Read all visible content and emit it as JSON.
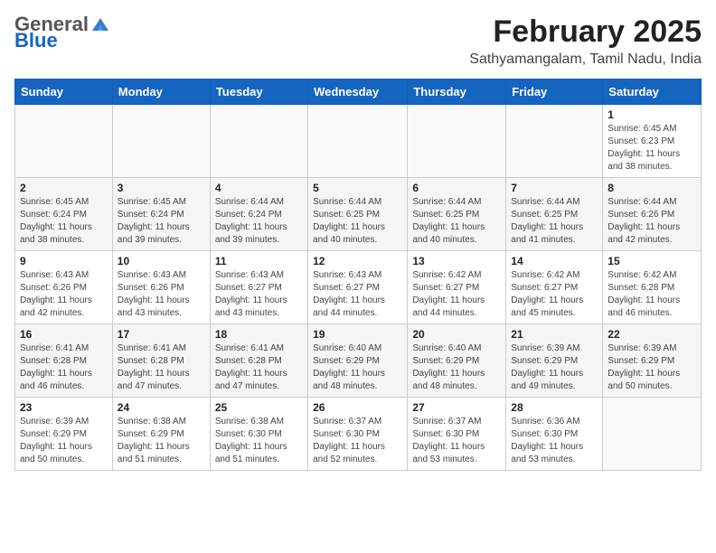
{
  "header": {
    "logo_general": "General",
    "logo_blue": "Blue",
    "month_title": "February 2025",
    "location": "Sathyamangalam, Tamil Nadu, India"
  },
  "days_of_week": [
    "Sunday",
    "Monday",
    "Tuesday",
    "Wednesday",
    "Thursday",
    "Friday",
    "Saturday"
  ],
  "weeks": [
    [
      {
        "day": "",
        "info": ""
      },
      {
        "day": "",
        "info": ""
      },
      {
        "day": "",
        "info": ""
      },
      {
        "day": "",
        "info": ""
      },
      {
        "day": "",
        "info": ""
      },
      {
        "day": "",
        "info": ""
      },
      {
        "day": "1",
        "info": "Sunrise: 6:45 AM\nSunset: 6:23 PM\nDaylight: 11 hours and 38 minutes."
      }
    ],
    [
      {
        "day": "2",
        "info": "Sunrise: 6:45 AM\nSunset: 6:24 PM\nDaylight: 11 hours and 38 minutes."
      },
      {
        "day": "3",
        "info": "Sunrise: 6:45 AM\nSunset: 6:24 PM\nDaylight: 11 hours and 39 minutes."
      },
      {
        "day": "4",
        "info": "Sunrise: 6:44 AM\nSunset: 6:24 PM\nDaylight: 11 hours and 39 minutes."
      },
      {
        "day": "5",
        "info": "Sunrise: 6:44 AM\nSunset: 6:25 PM\nDaylight: 11 hours and 40 minutes."
      },
      {
        "day": "6",
        "info": "Sunrise: 6:44 AM\nSunset: 6:25 PM\nDaylight: 11 hours and 40 minutes."
      },
      {
        "day": "7",
        "info": "Sunrise: 6:44 AM\nSunset: 6:25 PM\nDaylight: 11 hours and 41 minutes."
      },
      {
        "day": "8",
        "info": "Sunrise: 6:44 AM\nSunset: 6:26 PM\nDaylight: 11 hours and 42 minutes."
      }
    ],
    [
      {
        "day": "9",
        "info": "Sunrise: 6:43 AM\nSunset: 6:26 PM\nDaylight: 11 hours and 42 minutes."
      },
      {
        "day": "10",
        "info": "Sunrise: 6:43 AM\nSunset: 6:26 PM\nDaylight: 11 hours and 43 minutes."
      },
      {
        "day": "11",
        "info": "Sunrise: 6:43 AM\nSunset: 6:27 PM\nDaylight: 11 hours and 43 minutes."
      },
      {
        "day": "12",
        "info": "Sunrise: 6:43 AM\nSunset: 6:27 PM\nDaylight: 11 hours and 44 minutes."
      },
      {
        "day": "13",
        "info": "Sunrise: 6:42 AM\nSunset: 6:27 PM\nDaylight: 11 hours and 44 minutes."
      },
      {
        "day": "14",
        "info": "Sunrise: 6:42 AM\nSunset: 6:27 PM\nDaylight: 11 hours and 45 minutes."
      },
      {
        "day": "15",
        "info": "Sunrise: 6:42 AM\nSunset: 6:28 PM\nDaylight: 11 hours and 46 minutes."
      }
    ],
    [
      {
        "day": "16",
        "info": "Sunrise: 6:41 AM\nSunset: 6:28 PM\nDaylight: 11 hours and 46 minutes."
      },
      {
        "day": "17",
        "info": "Sunrise: 6:41 AM\nSunset: 6:28 PM\nDaylight: 11 hours and 47 minutes."
      },
      {
        "day": "18",
        "info": "Sunrise: 6:41 AM\nSunset: 6:28 PM\nDaylight: 11 hours and 47 minutes."
      },
      {
        "day": "19",
        "info": "Sunrise: 6:40 AM\nSunset: 6:29 PM\nDaylight: 11 hours and 48 minutes."
      },
      {
        "day": "20",
        "info": "Sunrise: 6:40 AM\nSunset: 6:29 PM\nDaylight: 11 hours and 48 minutes."
      },
      {
        "day": "21",
        "info": "Sunrise: 6:39 AM\nSunset: 6:29 PM\nDaylight: 11 hours and 49 minutes."
      },
      {
        "day": "22",
        "info": "Sunrise: 6:39 AM\nSunset: 6:29 PM\nDaylight: 11 hours and 50 minutes."
      }
    ],
    [
      {
        "day": "23",
        "info": "Sunrise: 6:39 AM\nSunset: 6:29 PM\nDaylight: 11 hours and 50 minutes."
      },
      {
        "day": "24",
        "info": "Sunrise: 6:38 AM\nSunset: 6:29 PM\nDaylight: 11 hours and 51 minutes."
      },
      {
        "day": "25",
        "info": "Sunrise: 6:38 AM\nSunset: 6:30 PM\nDaylight: 11 hours and 51 minutes."
      },
      {
        "day": "26",
        "info": "Sunrise: 6:37 AM\nSunset: 6:30 PM\nDaylight: 11 hours and 52 minutes."
      },
      {
        "day": "27",
        "info": "Sunrise: 6:37 AM\nSunset: 6:30 PM\nDaylight: 11 hours and 53 minutes."
      },
      {
        "day": "28",
        "info": "Sunrise: 6:36 AM\nSunset: 6:30 PM\nDaylight: 11 hours and 53 minutes."
      },
      {
        "day": "",
        "info": ""
      }
    ]
  ]
}
